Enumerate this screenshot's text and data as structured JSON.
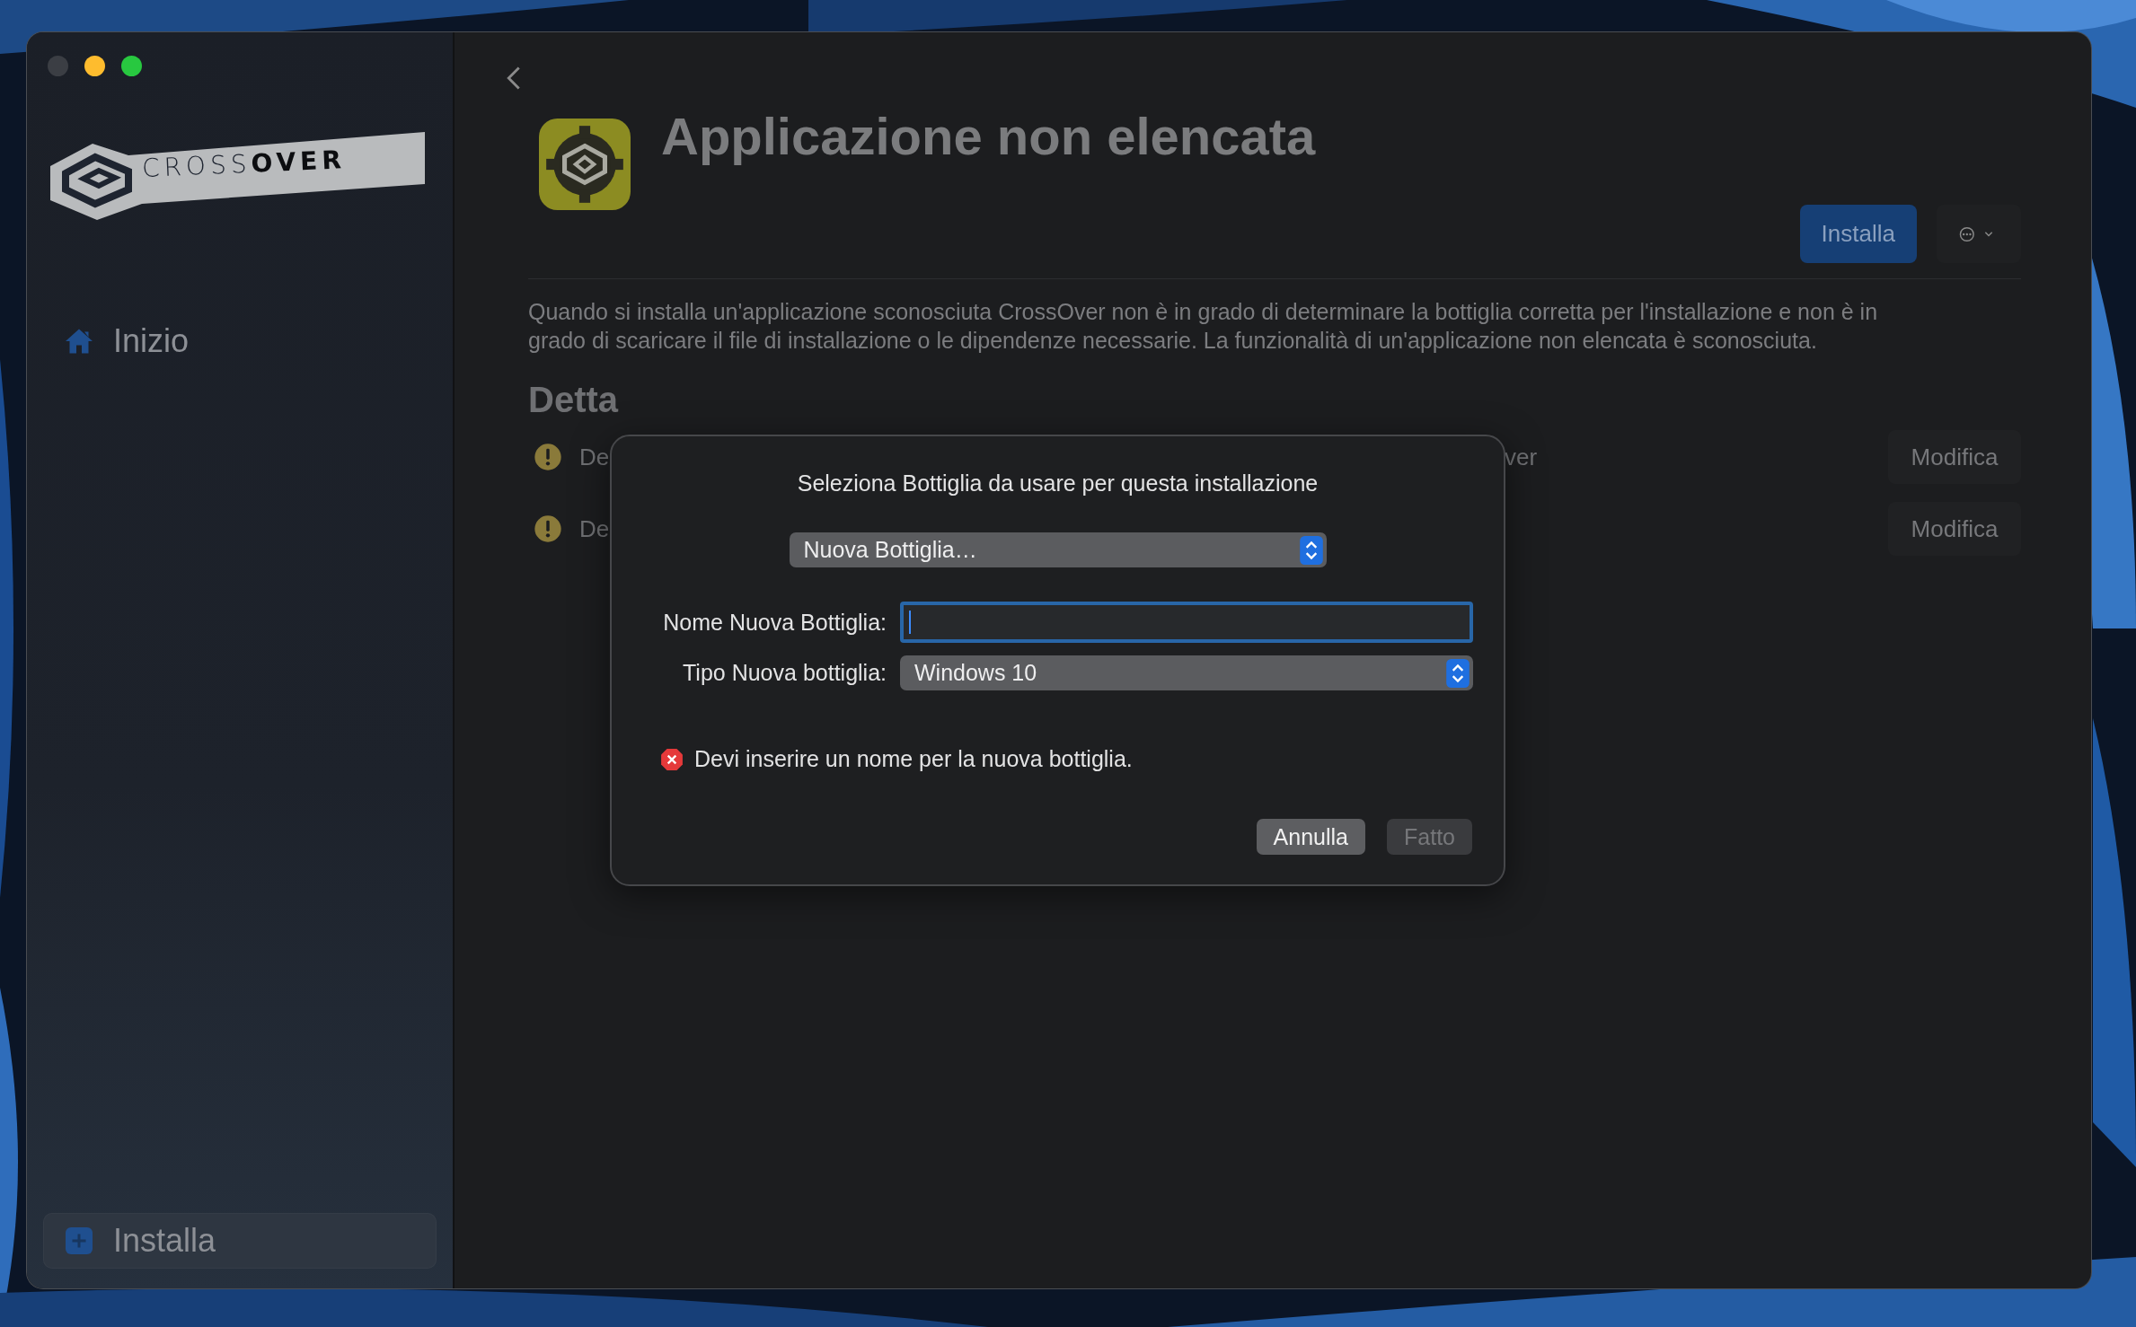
{
  "window": {
    "traffic_lights": [
      {
        "color": "#3b3e44"
      },
      {
        "color": "#febc2e"
      },
      {
        "color": "#28c840"
      }
    ]
  },
  "sidebar": {
    "logo": "CROSS**OVER**",
    "items": [
      {
        "label": "Inizio",
        "selected": false
      }
    ],
    "footer": {
      "label": "Installa",
      "selected": true
    }
  },
  "page": {
    "title": "Applicazione non elencata",
    "install_button": "Installa",
    "description": "Quando si installa un'applicazione sconosciuta CrossOver non è in grado di determinare la bottiglia corretta per l'installazione e non è in grado di scaricare il file di installazione o le dipendenze necessarie. La funzionalità di un'applicazione non elencata è sconosciuta.",
    "details_heading": "Detta",
    "details": [
      {
        "left": "De",
        "right": "ver",
        "button": "Modifica"
      },
      {
        "left": "De",
        "button": "Modifica"
      }
    ]
  },
  "dialog": {
    "title": "Seleziona Bottiglia da usare per questa installazione",
    "bottle_select": "Nuova Bottiglia…",
    "fields": [
      {
        "kind": "text",
        "label": "Nome Nuova Bottiglia:",
        "focused": true
      },
      {
        "kind": "select",
        "label": "Tipo Nuova bottiglia:",
        "value": "Windows 10"
      }
    ],
    "error": "Devi inserire un nome per la nuova bottiglia.",
    "buttons": [
      {
        "label": "Annulla",
        "disabled": false
      },
      {
        "label": "Fatto",
        "disabled": true
      }
    ]
  }
}
